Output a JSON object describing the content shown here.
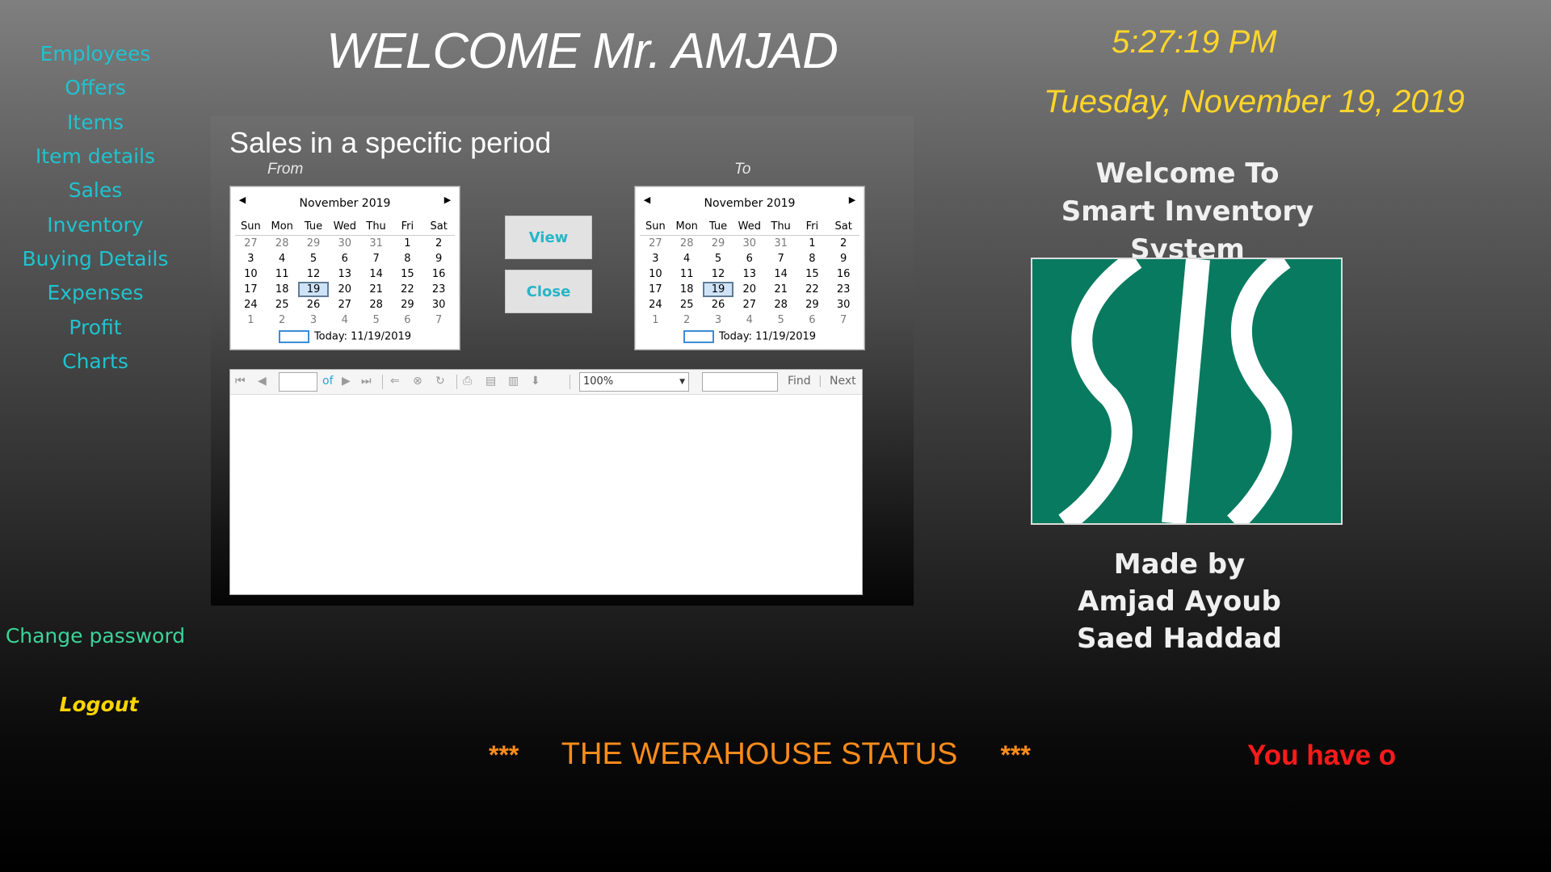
{
  "sidebar": {
    "items": [
      {
        "label": "Employees"
      },
      {
        "label": "Offers"
      },
      {
        "label": "Items"
      },
      {
        "label": "Item details"
      },
      {
        "label": "Sales"
      },
      {
        "label": "Inventory"
      },
      {
        "label": "Buying Details"
      },
      {
        "label": "Expenses"
      },
      {
        "label": "Profit"
      },
      {
        "label": "Charts"
      }
    ],
    "change_password": "Change password",
    "logout": "Logout"
  },
  "header": {
    "welcome": "WELCOME Mr. AMJAD",
    "time": "5:27:19 PM",
    "date": "Tuesday, November 19, 2019"
  },
  "info": {
    "welcome_line1": "Welcome To",
    "welcome_line2": "Smart Inventory System",
    "made_by": "Made by",
    "author1": "Amjad Ayoub",
    "author2": "Saed Haddad"
  },
  "panel": {
    "title": "Sales in a specific period",
    "from_label": "From",
    "to_label": "To",
    "view_button": "View",
    "close_button": "Close"
  },
  "calendar": {
    "month_label": "November 2019",
    "weekdays": [
      "Sun",
      "Mon",
      "Tue",
      "Wed",
      "Thu",
      "Fri",
      "Sat"
    ],
    "weeks": [
      [
        "27",
        "28",
        "29",
        "30",
        "31",
        "1",
        "2"
      ],
      [
        "3",
        "4",
        "5",
        "6",
        "7",
        "8",
        "9"
      ],
      [
        "10",
        "11",
        "12",
        "13",
        "14",
        "15",
        "16"
      ],
      [
        "17",
        "18",
        "19",
        "20",
        "21",
        "22",
        "23"
      ],
      [
        "24",
        "25",
        "26",
        "27",
        "28",
        "29",
        "30"
      ],
      [
        "1",
        "2",
        "3",
        "4",
        "5",
        "6",
        "7"
      ]
    ],
    "selected_day": "19",
    "today_text": "Today: 11/19/2019"
  },
  "report_toolbar": {
    "page_of": "of",
    "zoom": "100%",
    "find": "Find",
    "next": "Next",
    "separator": "|"
  },
  "footer": {
    "stars": "***",
    "status": "THE WERAHOUSE STATUS",
    "alert": "You have o"
  },
  "colors": {
    "nav_text": "#1fc3cf",
    "clock": "#ffd52a",
    "logo_green": "#087a5f",
    "status_orange": "#ff8c1a",
    "alert_red": "#ff1a1a"
  }
}
